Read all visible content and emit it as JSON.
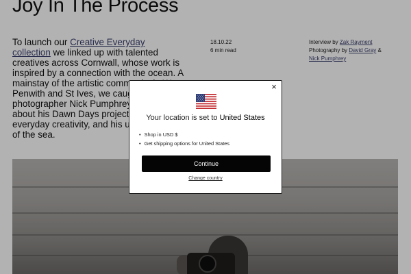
{
  "article": {
    "title": "Joy In The Process",
    "intro": {
      "text_before": "To launch our ",
      "link_text": "Creative Everyday collection",
      "text_after": " we linked up with talented creatives across Cornwall, whose work is inspired by a connection with the ocean. A mainstay of the artistic community in West Penwith and St Ives, we caught up with photographer Nick Pumphrey to talk about his Dawn Days project, fostering everyday creativity, and his undying love of the sea."
    },
    "date": "18.10.22",
    "read_time": "6 min read",
    "credits": {
      "interview_prefix": "Interview by ",
      "interviewer": "Zak Rayment",
      "photography_prefix": "Photography by ",
      "photographer_1": "David Gray",
      "and": " & ",
      "photographer_2": "Nick Pumphrey"
    }
  },
  "modal": {
    "location_prefix": "Your location is set to ",
    "country": "United States",
    "items": [
      "Shop in USD $",
      "Get shipping options for United States"
    ],
    "continue_label": "Continue",
    "change_label": "Change country",
    "close_glyph": "×"
  },
  "colors": {
    "link": "#3a3f6e",
    "button_bg": "#050505",
    "overlay": "rgba(0,0,0,0.30)"
  }
}
